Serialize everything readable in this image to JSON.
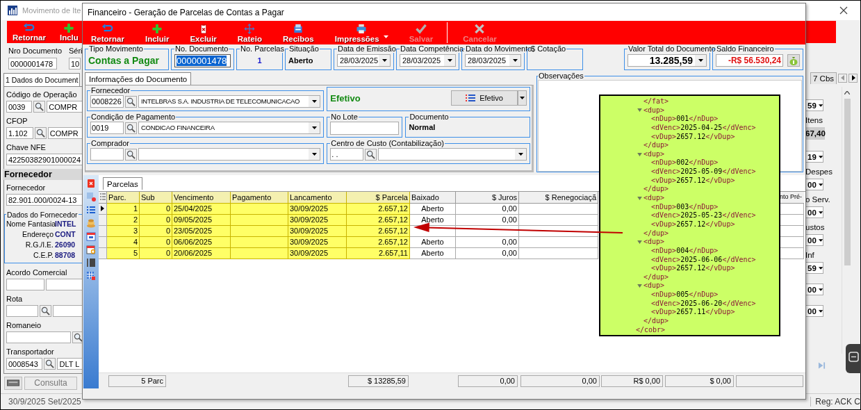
{
  "background_window": {
    "title": "Movimento de Ite",
    "toolbar": [
      {
        "label": "Retornar"
      },
      {
        "label": "Inclu"
      }
    ],
    "document_row": {
      "labels": [
        "Nro Documento",
        "Séri"
      ],
      "values": [
        "0000001478",
        "10"
      ]
    },
    "left_tab": {
      "label": "1 Dados do Document",
      "selected": true
    },
    "left_rows": [
      {
        "kind": "label",
        "text": "Código de Operação"
      },
      {
        "kind": "fields",
        "items": [
          {
            "kind": "input",
            "value": "0039"
          },
          {
            "kind": "search"
          },
          {
            "kind": "input",
            "value": "COMPR"
          }
        ]
      },
      {
        "kind": "label",
        "text": "CFOP"
      },
      {
        "kind": "fields",
        "items": [
          {
            "kind": "input",
            "value": "1.102"
          },
          {
            "kind": "search"
          },
          {
            "kind": "input",
            "value": "COMPR"
          }
        ]
      },
      {
        "kind": "label",
        "text": "Chave NFE"
      },
      {
        "kind": "fields",
        "items": [
          {
            "kind": "input",
            "value": "42250382901000024"
          }
        ]
      },
      {
        "kind": "header",
        "text": "Fornecedor"
      },
      {
        "kind": "label",
        "text": "Fornecedor"
      },
      {
        "kind": "fields",
        "items": [
          {
            "kind": "input",
            "value": "82.901.000/0024-13"
          }
        ]
      },
      {
        "kind": "group",
        "title": "Dados do Fornecedor",
        "pairs": [
          {
            "label": "Nome Fantasia",
            "value": "INTEL"
          },
          {
            "label": "Endereço",
            "value": "CONT"
          },
          {
            "label": "R.G./I.E.",
            "value": "26090"
          },
          {
            "label": "C.E.P.",
            "value": "88708"
          }
        ]
      },
      {
        "kind": "label",
        "text": "Acordo Comercial"
      },
      {
        "kind": "fields",
        "items": [
          {
            "kind": "input"
          },
          {
            "kind": "input"
          }
        ]
      },
      {
        "kind": "label",
        "text": "Rota"
      },
      {
        "kind": "fields",
        "items": [
          {
            "kind": "input"
          },
          {
            "kind": "search"
          },
          {
            "kind": "input"
          }
        ]
      },
      {
        "kind": "label",
        "text": "Romaneio"
      },
      {
        "kind": "fields",
        "items": [
          {
            "kind": "input"
          },
          {
            "kind": "search"
          }
        ]
      },
      {
        "kind": "label",
        "text": "Transportador"
      },
      {
        "kind": "fields",
        "items": [
          {
            "kind": "input",
            "value": "0008543"
          },
          {
            "kind": "search"
          },
          {
            "kind": "input",
            "value": "DLT L"
          }
        ]
      }
    ],
    "bottom_buttons": [
      {
        "kind": "keyboard"
      },
      {
        "kind": "text",
        "label": "Consulta"
      }
    ],
    "right_tab": {
      "label": "7 Cbs",
      "selected": false
    },
    "right_items": [
      {
        "kind": "combo",
        "value": "59"
      },
      {
        "kind": "label",
        "text": "Itens"
      },
      {
        "kind": "value",
        "text": "67,40"
      },
      {
        "kind": "combo",
        "value": "19"
      },
      {
        "kind": "label",
        "text": "Despes"
      },
      {
        "kind": "combo",
        "value": "00"
      },
      {
        "kind": "label",
        "text": "o Serv."
      },
      {
        "kind": "combo",
        "value": "00"
      },
      {
        "kind": "label",
        "text": "ustos"
      },
      {
        "kind": "combo",
        "value": "00"
      },
      {
        "kind": "label",
        "text": "Inf"
      },
      {
        "kind": "combo",
        "value": "59"
      },
      {
        "kind": "combo",
        "value": "00"
      },
      {
        "kind": "combo",
        "value": "00"
      }
    ],
    "status": [
      "30/9/2025 Set/2025",
      "Reg: ACK C"
    ]
  },
  "dialog": {
    "title": "Financeiro - Geração de Parcelas de Contas a Pagar",
    "toolbar": [
      {
        "kind": "button",
        "label": "Retornar",
        "disabled": false
      },
      {
        "kind": "button",
        "label": "Incluir",
        "disabled": false
      },
      {
        "kind": "button",
        "label": "Excluir",
        "disabled": false
      },
      {
        "kind": "button",
        "label": "Rateio",
        "disabled": false
      },
      {
        "kind": "button",
        "label": "Recibos",
        "disabled": false
      },
      {
        "kind": "button",
        "label": "Impressões",
        "disabled": false,
        "menu": true
      },
      {
        "kind": "button",
        "label": "Salvar",
        "disabled": true
      },
      {
        "kind": "separator"
      },
      {
        "kind": "button",
        "label": "Cancelar",
        "disabled": true
      }
    ],
    "header_fields": [
      {
        "label": "Tipo Movimento",
        "kind": "status",
        "value": "Contas a Pagar"
      },
      {
        "label": "No. Documento",
        "kind": "field",
        "value": "0000001478",
        "selected": true
      },
      {
        "label": "No. Parcelas",
        "kind": "count",
        "value": "1"
      },
      {
        "label": "Situação",
        "kind": "state",
        "value": "Aberto"
      },
      {
        "label": "Data de Emissão",
        "kind": "date",
        "value": "28/03/2025"
      },
      {
        "label": "Data Competência",
        "kind": "date",
        "value": "28/03/2025"
      },
      {
        "label": "Data do Movimento",
        "kind": "date",
        "value": "28/03/2025"
      },
      {
        "label": "$ Cotação",
        "kind": "empty"
      },
      {
        "label": "Valor Total do Documento",
        "kind": "total",
        "value": "13.285,59"
      },
      {
        "label": "Saldo Financeiro",
        "kind": "balance",
        "value": "-R$ 56.530,24"
      }
    ],
    "info_tabs": [
      {
        "label": "Informações do Documento",
        "selected": true
      }
    ],
    "info_rows": [
      [
        {
          "label": "Fornecedor",
          "kind": "lookup",
          "code": "0008226",
          "value": "INTELBRAS S.A. INDUSTRIA DE TELECOMUNICACAO"
        },
        {
          "kind": "efetivo",
          "value": "Efetivo",
          "button": "Efetivo"
        }
      ],
      [
        {
          "label": "Condição de Pagamento",
          "kind": "lookup",
          "code": "0019",
          "value": "CONDICAO FINANCEIRA"
        },
        {
          "label": "No Lote",
          "kind": "input"
        },
        {
          "label": "Documento",
          "kind": "text",
          "value": "Normal"
        }
      ],
      [
        {
          "label": "Comprador",
          "kind": "lookup"
        },
        {
          "label": "Centro de Custo (Contabilização)",
          "kind": "lookup",
          "code": ". ."
        }
      ]
    ],
    "observacoes": {
      "label": "Observações"
    },
    "parcel_tabs": [
      {
        "label": "Parcelas",
        "selected": true
      }
    ],
    "columns": [
      {
        "label": "Parc.",
        "highlighted": true
      },
      {
        "label": "Sub",
        "highlighted": true
      },
      {
        "label": "Vencimento",
        "highlighted": true
      },
      {
        "label": "Pagamento",
        "highlighted": true
      },
      {
        "label": "Lancamento",
        "highlighted": true
      },
      {
        "label": "$ Parcela",
        "highlighted": true
      },
      {
        "label": "Baixado",
        "highlighted": false
      },
      {
        "label": "$ Juros",
        "highlighted": false
      },
      {
        "label": "$ Renegociaçã",
        "highlighted": false
      },
      {
        "label": "nto Pré-",
        "highlighted": false
      }
    ],
    "rows": [
      {
        "parc": "1",
        "sub": "0",
        "vencimento": "25/04/2025",
        "lancamento": "30/09/2025",
        "parcela": "2.657,12",
        "baixado": "Aberto",
        "juros": "0,00",
        "current": true
      },
      {
        "parc": "2",
        "sub": "0",
        "vencimento": "09/05/2025",
        "lancamento": "30/09/2025",
        "parcela": "2.657,12",
        "baixado": "Aberto",
        "juros": "0,00",
        "current": false
      },
      {
        "parc": "3",
        "sub": "0",
        "vencimento": "23/05/2025",
        "lancamento": "30/09/2025",
        "parcela": "2.657,12",
        "current": false
      },
      {
        "parc": "4",
        "sub": "0",
        "vencimento": "06/06/2025",
        "lancamento": "30/09/2025",
        "parcela": "2.657,12",
        "baixado": "Aberto",
        "juros": "0,00",
        "current": false
      },
      {
        "parc": "5",
        "sub": "0",
        "vencimento": "20/06/2025",
        "lancamento": "30/09/2025",
        "parcela": "2.657,11",
        "baixado": "Aberto",
        "juros": "0,00",
        "current": false
      }
    ],
    "footer": [
      "5 Parc",
      "$ 13285,59",
      "0,00",
      "0,00",
      "R$ 0,00",
      "$ 0,00"
    ]
  },
  "xml_callout": {
    "nodes": [
      {
        "kind": "text",
        "text": "</fat>"
      },
      {
        "kind": "element",
        "open": "<dup>",
        "expanded": true,
        "close": "</dup>",
        "children": [
          {
            "open": "<nDup>",
            "value": "001",
            "close": "</nDup>"
          },
          {
            "open": "<dVenc>",
            "value": "2025-04-25",
            "close": "</dVenc>"
          },
          {
            "open": "<vDup>",
            "value": "2657.12",
            "close": "</vDup>"
          }
        ]
      },
      {
        "kind": "element",
        "open": "<dup>",
        "expanded": true,
        "close": "</dup>",
        "children": [
          {
            "open": "<nDup>",
            "value": "002",
            "close": "</nDup>"
          },
          {
            "open": "<dVenc>",
            "value": "2025-05-09",
            "close": "</dVenc>"
          },
          {
            "open": "<vDup>",
            "value": "2657.12",
            "close": "</vDup>"
          }
        ]
      },
      {
        "kind": "element",
        "open": "<dup>",
        "expanded": true,
        "close": "</dup>",
        "children": [
          {
            "open": "<nDup>",
            "value": "003",
            "close": "</nDup>"
          },
          {
            "open": "<dVenc>",
            "value": "2025-05-23",
            "close": "</dVenc>"
          },
          {
            "open": "<vDup>",
            "value": "2657.12",
            "close": "</vDup>"
          }
        ]
      },
      {
        "kind": "element",
        "open": "<dup>",
        "expanded": true,
        "close": "</dup>",
        "children": [
          {
            "open": "<nDup>",
            "value": "004",
            "close": "</nDup>"
          },
          {
            "open": "<dVenc>",
            "value": "2025-06-06",
            "close": "</dVenc>"
          },
          {
            "open": "<vDup>",
            "value": "2657.12",
            "close": "</vDup>"
          }
        ]
      },
      {
        "kind": "element",
        "open": "<dup>",
        "expanded": true,
        "close": "</dup>",
        "children": [
          {
            "open": "<nDup>",
            "value": "005",
            "close": "</nDup>"
          },
          {
            "open": "<dVenc>",
            "value": "2025-06-20",
            "close": "</dVenc>"
          },
          {
            "open": "<vDup>",
            "value": "2657.11",
            "close": "</vDup>"
          }
        ]
      },
      {
        "kind": "closing",
        "text": "</cobr>"
      }
    ]
  }
}
